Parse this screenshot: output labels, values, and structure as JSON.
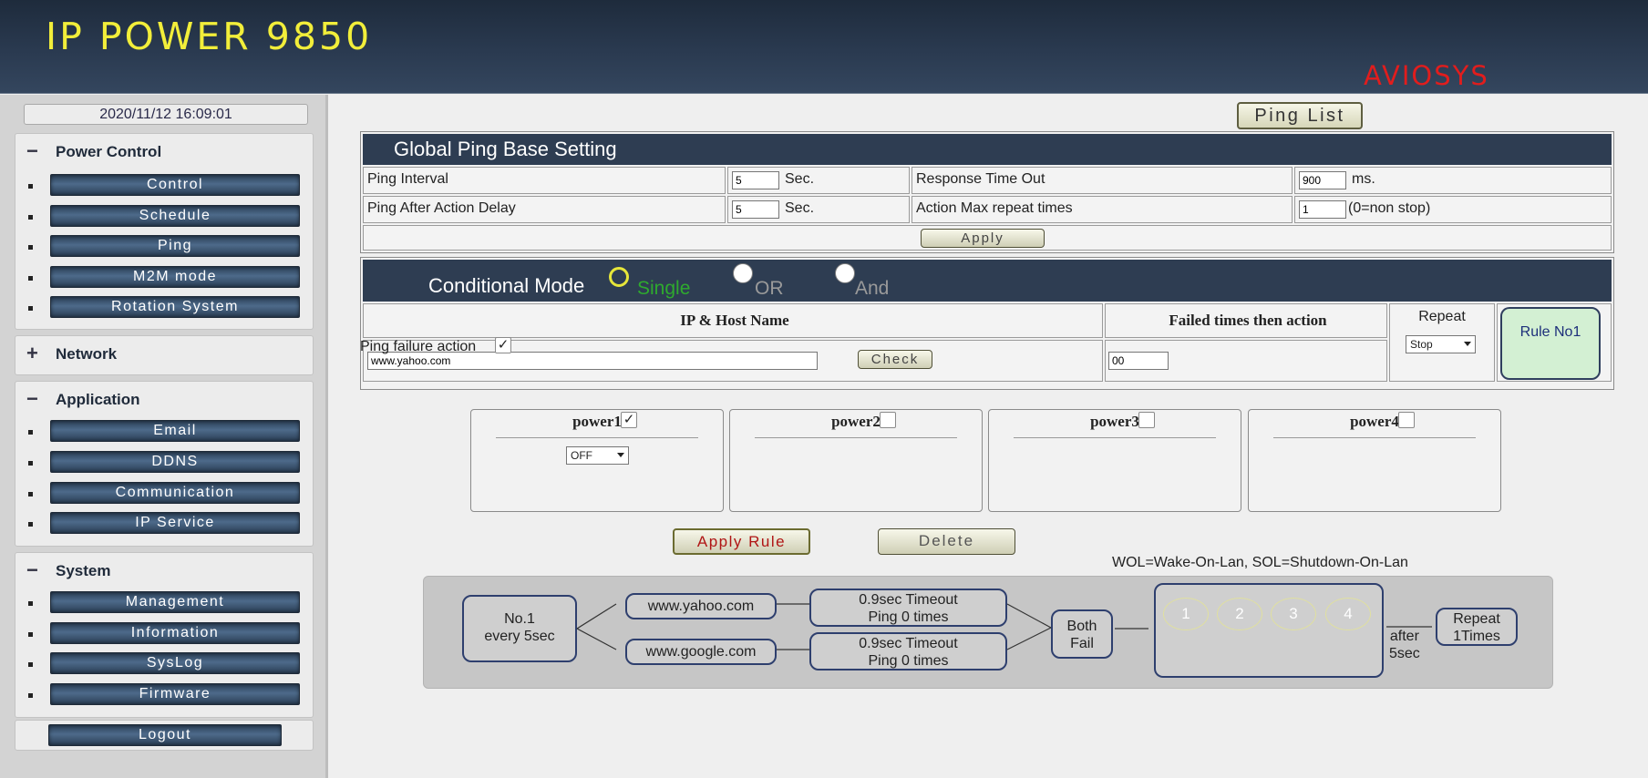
{
  "header": {
    "title": "IP POWER 9850",
    "vendor": "AVIOSYS"
  },
  "sidebar": {
    "datetime": "2020/11/12 16:09:01",
    "sections": [
      {
        "sign": "−",
        "title": "Power Control",
        "items": [
          "Control",
          "Schedule",
          "Ping",
          "M2M mode",
          "Rotation System"
        ]
      },
      {
        "sign": "+",
        "title": "Network",
        "items": []
      },
      {
        "sign": "−",
        "title": "Application",
        "items": [
          "Email",
          "DDNS",
          "Communication",
          "IP Service"
        ]
      },
      {
        "sign": "−",
        "title": "System",
        "items": [
          "Management",
          "Information",
          "SysLog",
          "Firmware"
        ]
      }
    ],
    "logout": "Logout"
  },
  "main": {
    "ping_list_button": "Ping List",
    "global": {
      "title": "Global Ping Base Setting",
      "ping_interval_label": "Ping Interval",
      "ping_interval_value": "5",
      "sec_unit": "Sec.",
      "response_timeout_label": "Response Time Out",
      "response_timeout_value": "900",
      "ms_unit": "ms.",
      "after_action_label": "Ping After Action Delay",
      "after_action_value": "5",
      "max_repeat_label": "Action Max repeat times",
      "max_repeat_value": "1",
      "max_repeat_hint": "(0=non stop)",
      "apply": "Apply"
    },
    "conditional": {
      "title": "Conditional Mode",
      "modes": [
        "Single",
        "OR",
        "And"
      ],
      "selected": "Single",
      "ip_header": "IP & Host Name",
      "failed_header": "Failed times then action",
      "repeat_header": "Repeat",
      "host_value": "www.yahoo.com",
      "check": "Check",
      "failed_value": "00",
      "repeat_value": "Stop",
      "rule_button": "Rule No1"
    },
    "failure": {
      "label": "Ping failure action",
      "checkmark": "✓",
      "powers": [
        {
          "name": "power1",
          "checked": true,
          "action": "OFF"
        },
        {
          "name": "power2",
          "checked": false
        },
        {
          "name": "power3",
          "checked": false
        },
        {
          "name": "power4",
          "checked": false
        }
      ]
    },
    "apply_rule": "Apply Rule",
    "delete": "Delete",
    "legend": "WOL=Wake-On-Lan, SOL=Shutdown-On-Lan",
    "diagram": {
      "rule_line1": "No.1",
      "rule_line2": "every 5sec",
      "host1": "www.yahoo.com",
      "host2": "www.google.com",
      "timeout1_line1": "0.9sec Timeout",
      "timeout1_line2": "Ping 0 times",
      "timeout2_line1": "0.9sec Timeout",
      "timeout2_line2": "Ping 0 times",
      "cond_line1": "Both",
      "cond_line2": "Fail",
      "outlets": [
        "1",
        "2",
        "3",
        "4"
      ],
      "after_line1": "after",
      "after_line2": "5sec",
      "repeat_line1": "Repeat",
      "repeat_line2": "1Times"
    }
  },
  "colors": {
    "header_bg": "#2a3a50",
    "brand": "#f2ee3a",
    "vendor": "#e11d1d",
    "single_mode": "#2eaa2e",
    "rule_button_bg": "#d3f0d3",
    "apply_rule_text": "#b01515"
  }
}
